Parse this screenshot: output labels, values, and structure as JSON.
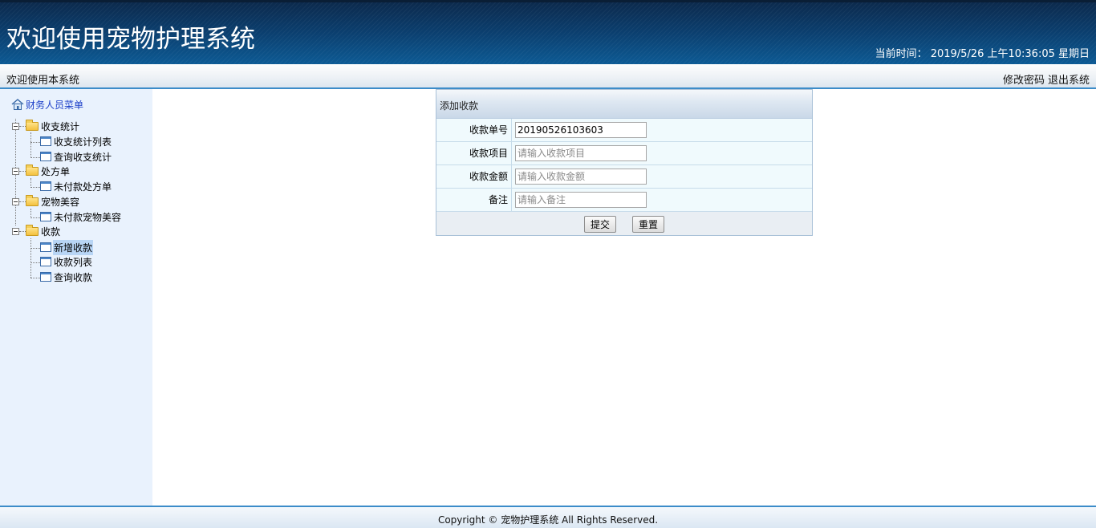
{
  "header": {
    "title": "欢迎使用宠物护理系统",
    "time_label": "当前时间：",
    "time_value": "2019/5/26 上午10:36:05 星期日"
  },
  "subbar": {
    "welcome": "欢迎使用本系统",
    "change_password": "修改密码",
    "logout": "退出系统"
  },
  "sidebar": {
    "root": "财务人员菜单",
    "groups": [
      {
        "label": "收支统计",
        "items": [
          "收支统计列表",
          "查询收支统计"
        ]
      },
      {
        "label": "处方单",
        "items": [
          "未付款处方单"
        ]
      },
      {
        "label": "宠物美容",
        "items": [
          "未付款宠物美容"
        ]
      },
      {
        "label": "收款",
        "items": [
          "新增收款",
          "收款列表",
          "查询收款"
        ]
      }
    ],
    "selected": "新增收款"
  },
  "form": {
    "title": "添加收款",
    "fields": [
      {
        "label": "收款单号",
        "value": "20190526103603",
        "placeholder": ""
      },
      {
        "label": "收款项目",
        "value": "",
        "placeholder": "请输入收款项目"
      },
      {
        "label": "收款金额",
        "value": "",
        "placeholder": "请输入收款金额"
      },
      {
        "label": "备注",
        "value": "",
        "placeholder": "请输入备注"
      }
    ],
    "submit": "提交",
    "reset": "重置"
  },
  "footer": {
    "copyright": "Copyright © 宠物护理系统 All Rights Reserved."
  },
  "colors": {
    "header_dark": "#0c2a4d",
    "header_light": "#0d5a94",
    "accent_line": "#3c8cc9",
    "sidebar_bg": "#e9f2fd"
  }
}
